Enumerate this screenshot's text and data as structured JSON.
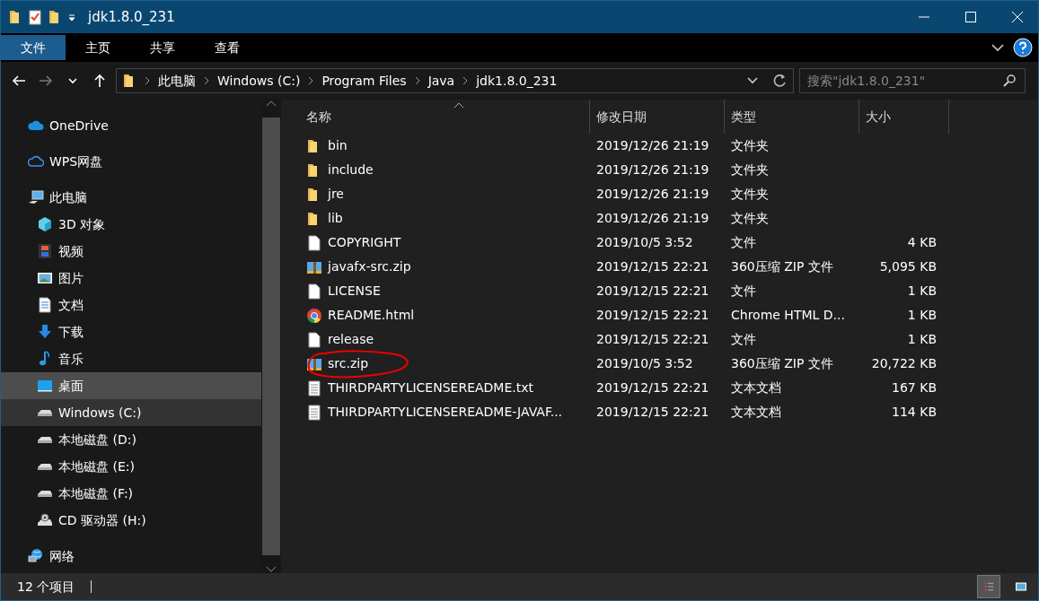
{
  "window": {
    "title": "jdk1.8.0_231"
  },
  "ribbon_tabs": [
    {
      "label": "文件",
      "selected": true
    },
    {
      "label": "主页",
      "selected": false
    },
    {
      "label": "共享",
      "selected": false
    },
    {
      "label": "查看",
      "selected": false
    }
  ],
  "breadcrumb": [
    "此电脑",
    "Windows (C:)",
    "Program Files",
    "Java",
    "jdk1.8.0_231"
  ],
  "search": {
    "placeholder": "搜索\"jdk1.8.0_231\""
  },
  "sidebar": {
    "items": [
      {
        "label": "OneDrive",
        "kind": "cloud",
        "selected": false,
        "hovered": false
      },
      {
        "label": "WPS网盘",
        "kind": "cloud-outline",
        "selected": false,
        "hovered": false
      },
      {
        "label": "此电脑",
        "kind": "computer",
        "selected": false,
        "hovered": false,
        "children": [
          {
            "label": "3D 对象",
            "kind": "cube",
            "selected": false,
            "hovered": false
          },
          {
            "label": "视频",
            "kind": "film",
            "selected": false,
            "hovered": false
          },
          {
            "label": "图片",
            "kind": "picture",
            "selected": false,
            "hovered": false
          },
          {
            "label": "文档",
            "kind": "document",
            "selected": false,
            "hovered": false
          },
          {
            "label": "下载",
            "kind": "download",
            "selected": false,
            "hovered": false
          },
          {
            "label": "音乐",
            "kind": "music",
            "selected": false,
            "hovered": false
          },
          {
            "label": "桌面",
            "kind": "desktop",
            "selected": false,
            "hovered": true
          },
          {
            "label": "Windows (C:)",
            "kind": "drive",
            "selected": true,
            "hovered": false
          },
          {
            "label": "本地磁盘 (D:)",
            "kind": "drive",
            "selected": false,
            "hovered": false
          },
          {
            "label": "本地磁盘 (E:)",
            "kind": "drive",
            "selected": false,
            "hovered": false
          },
          {
            "label": "本地磁盘 (F:)",
            "kind": "drive",
            "selected": false,
            "hovered": false
          },
          {
            "label": "CD 驱动器 (H:)",
            "kind": "cd",
            "selected": false,
            "hovered": false
          }
        ]
      },
      {
        "label": "网络",
        "kind": "network",
        "selected": false,
        "hovered": false
      }
    ]
  },
  "table": {
    "columns": [
      "名称",
      "修改日期",
      "类型",
      "大小"
    ],
    "rows": [
      {
        "kind": "folder",
        "name": "bin",
        "date": "2019/12/26 21:19",
        "type": "文件夹",
        "annotated": false
      },
      {
        "kind": "folder",
        "name": "include",
        "date": "2019/12/26 21:19",
        "type": "文件夹",
        "annotated": false
      },
      {
        "kind": "folder",
        "name": "jre",
        "date": "2019/12/26 21:19",
        "type": "文件夹",
        "annotated": false
      },
      {
        "kind": "folder",
        "name": "lib",
        "date": "2019/12/26 21:19",
        "type": "文件夹",
        "annotated": false
      },
      {
        "kind": "file",
        "name": "COPYRIGHT",
        "date": "2019/10/5 3:52",
        "type": "文件",
        "size": "4 KB",
        "annotated": false
      },
      {
        "kind": "zip",
        "name": "javafx-src.zip",
        "date": "2019/12/15 22:21",
        "type": "360压缩 ZIP 文件",
        "size": "5,095 KB",
        "annotated": false
      },
      {
        "kind": "file",
        "name": "LICENSE",
        "date": "2019/12/15 22:21",
        "type": "文件",
        "size": "1 KB",
        "annotated": false
      },
      {
        "kind": "chrome",
        "name": "README.html",
        "date": "2019/12/15 22:21",
        "type": "Chrome HTML D...",
        "size": "1 KB",
        "annotated": false
      },
      {
        "kind": "file",
        "name": "release",
        "date": "2019/12/15 22:21",
        "type": "文件",
        "size": "1 KB",
        "annotated": false
      },
      {
        "kind": "zip",
        "name": "src.zip",
        "date": "2019/10/5 3:52",
        "type": "360压缩 ZIP 文件",
        "size": "20,722 KB",
        "annotated": true
      },
      {
        "kind": "text",
        "name": "THIRDPARTYLICENSEREADME.txt",
        "date": "2019/12/15 22:21",
        "type": "文本文档",
        "size": "167 KB",
        "annotated": false
      },
      {
        "kind": "text",
        "name": "THIRDPARTYLICENSEREADME-JAVAF...",
        "date": "2019/12/15 22:21",
        "type": "文本文档",
        "size": "114 KB",
        "annotated": false
      }
    ]
  },
  "status_bar": {
    "item_count": "12 个项目",
    "view_buttons": [
      {
        "kind": "details",
        "selected": true
      },
      {
        "kind": "large-icons",
        "selected": false
      }
    ]
  }
}
